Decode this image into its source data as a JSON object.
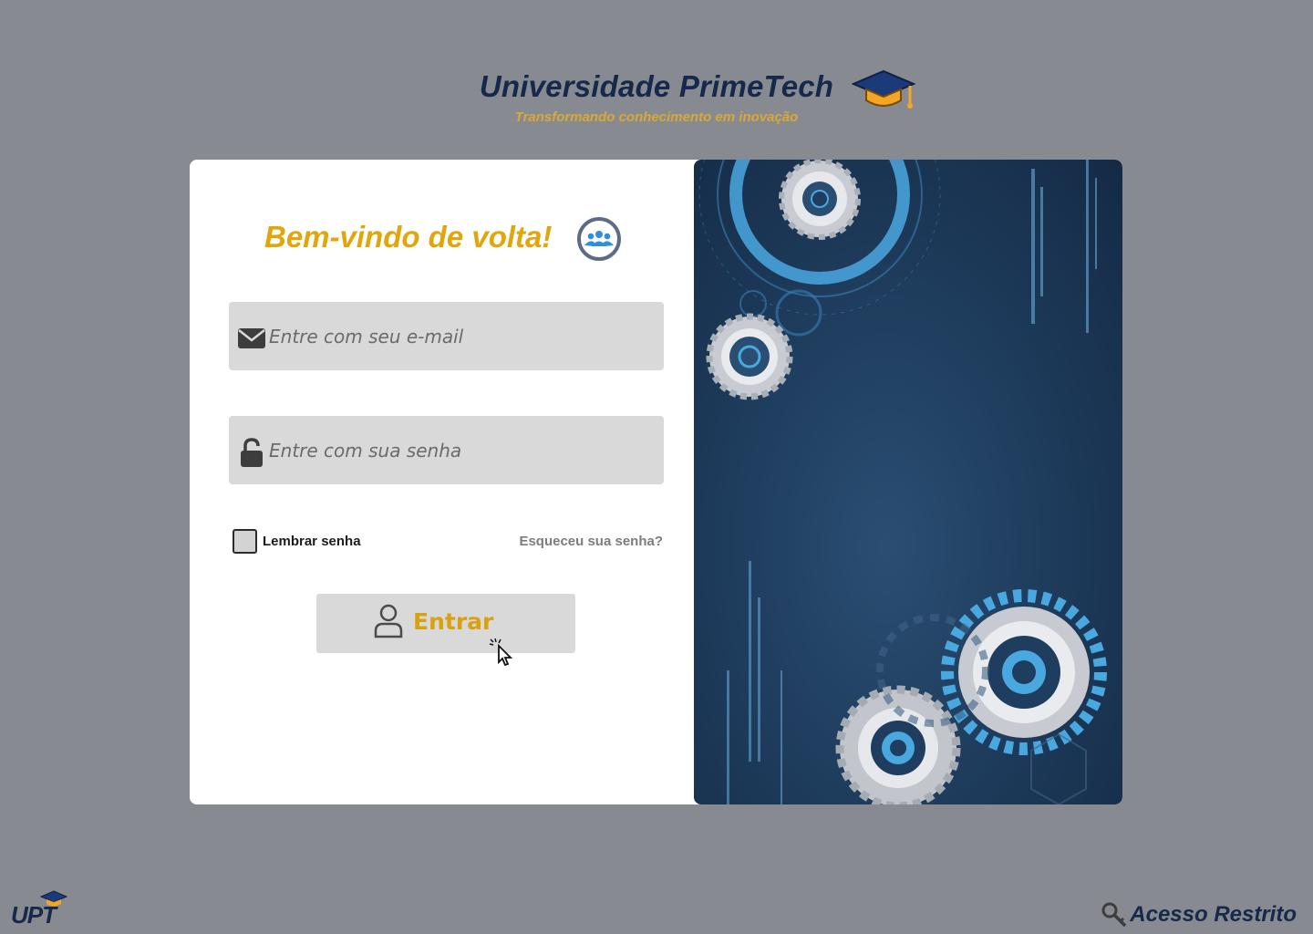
{
  "header": {
    "title": "Universidade PrimeTech",
    "subtitle": "Transformando conhecimento em inovação",
    "icon": "graduation-cap-icon"
  },
  "login_form": {
    "heading": "Bem-vindo de volta!",
    "heading_icon": "users-group-icon",
    "email": {
      "placeholder": "Entre com seu e-mail",
      "value": "",
      "icon": "envelope-icon"
    },
    "password": {
      "placeholder": "Entre com sua senha",
      "value": "",
      "icon": "lock-icon"
    },
    "remember_label": "Lembrar senha",
    "remember_checked": false,
    "forgot_link": "Esqueceu sua senha?",
    "submit_label": "Entrar",
    "submit_icon": "user-icon"
  },
  "footer": {
    "logo_text": "UPT",
    "restricted_label": "Acesso Restrito",
    "restricted_icon": "key-icon"
  },
  "colors": {
    "background": "#878b91",
    "navy": "#16294a",
    "gold": "#e2a50a",
    "field": "#d9d9d9",
    "art_blue": "#1f3d5e",
    "accent_cyan": "#4aa8e0"
  }
}
